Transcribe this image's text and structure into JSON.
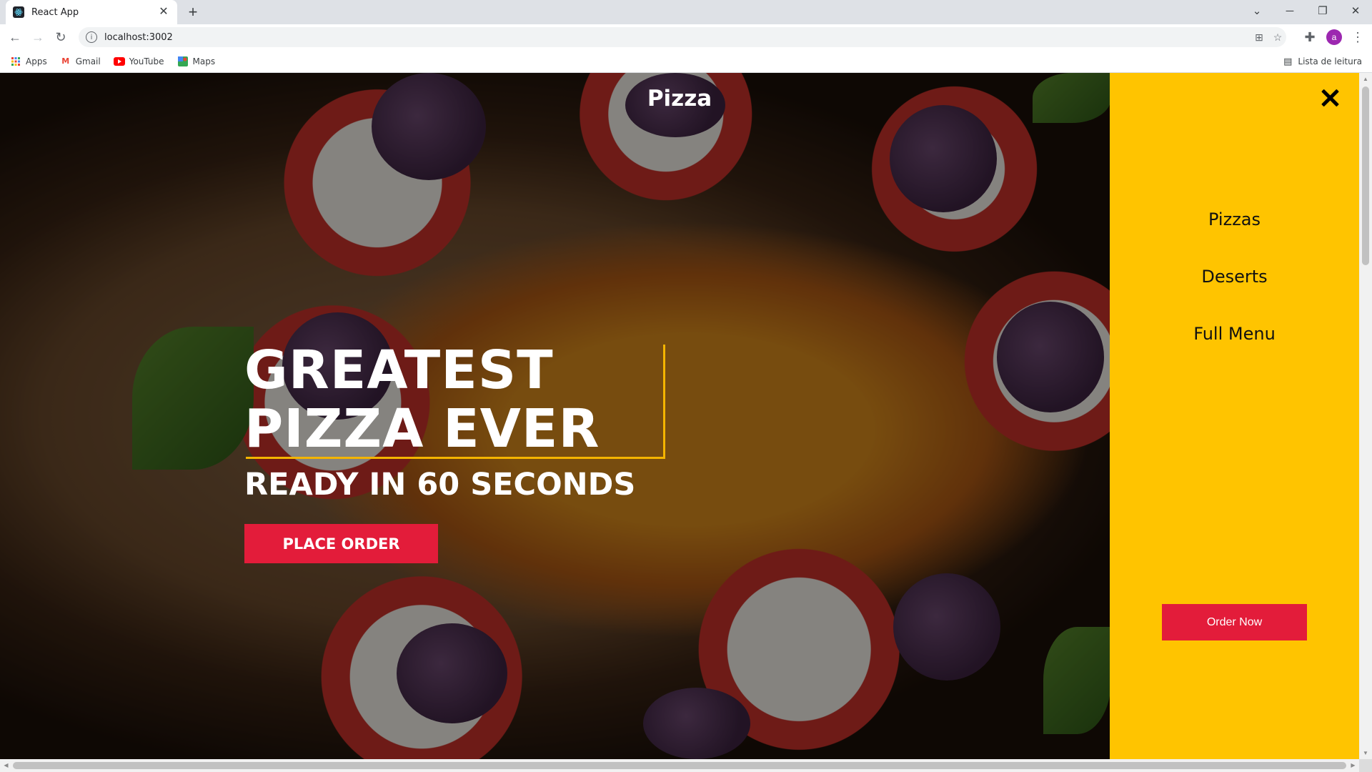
{
  "browser": {
    "tab_title": "React App",
    "tab_close": "✕",
    "new_tab": "+",
    "url": "localhost:3002",
    "profile_initial": "a",
    "bookmarks": [
      {
        "label": "Apps",
        "icon": "apps-grid-icon"
      },
      {
        "label": "Gmail",
        "icon": "gmail-icon"
      },
      {
        "label": "YouTube",
        "icon": "youtube-icon"
      },
      {
        "label": "Maps",
        "icon": "maps-icon"
      }
    ],
    "reading_list": "Lista de leitura"
  },
  "page": {
    "brand": "Pizza",
    "hero": {
      "headline_line1": "GREATEST",
      "headline_line2": "PIZZA EVER",
      "subline": "READY IN 60 SECONDS",
      "cta": "PLACE ORDER"
    },
    "drawer": {
      "links": [
        "Pizzas",
        "Deserts",
        "Full Menu"
      ],
      "cta": "Order Now"
    }
  },
  "colors": {
    "drawer_bg": "#ffc400",
    "accent_red": "#e31c3a",
    "frame_gold": "#f4b400"
  }
}
